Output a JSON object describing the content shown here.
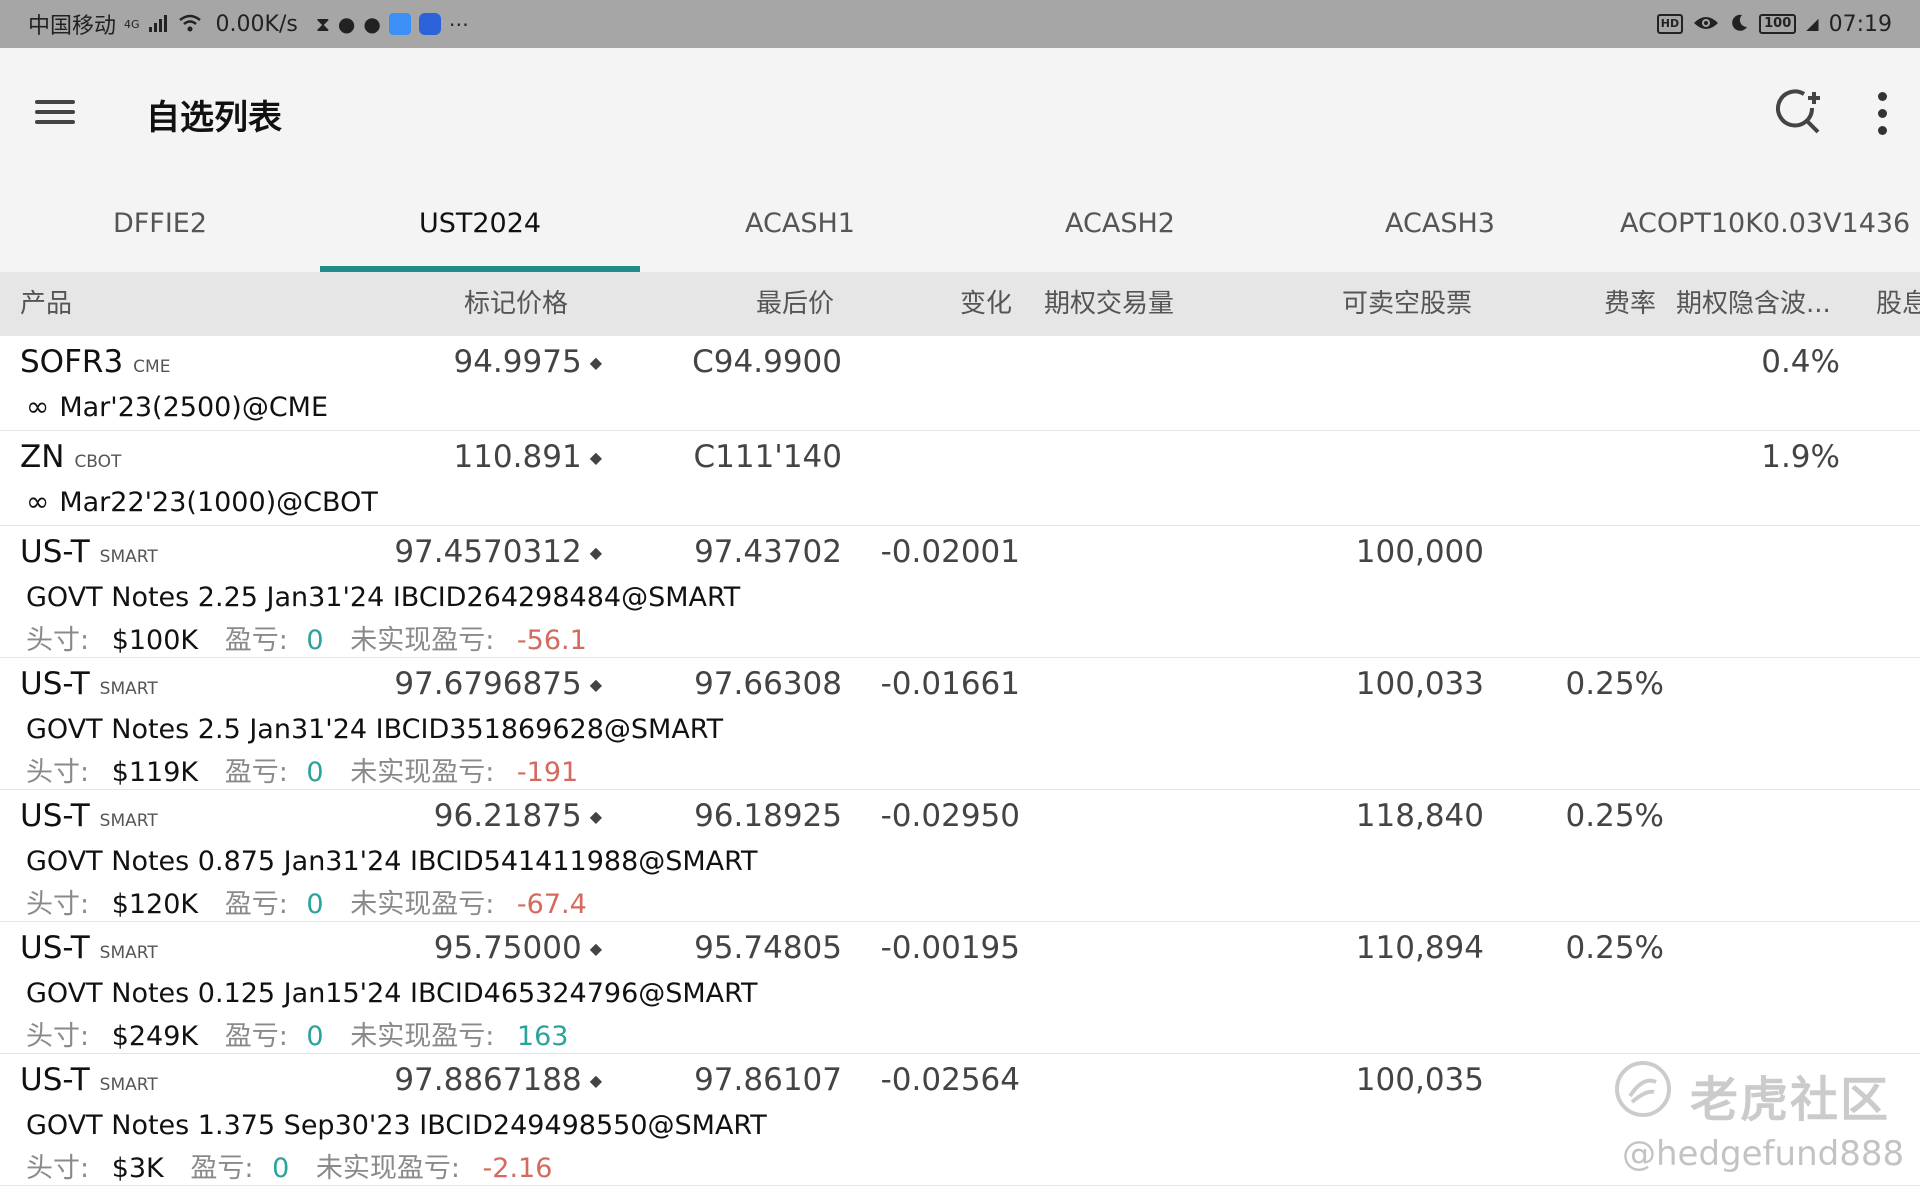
{
  "status_bar": {
    "carrier": "中国移动",
    "network": "4G",
    "speed": "0.00K/s",
    "hd": "HD",
    "battery": "100",
    "time": "07:19"
  },
  "appbar": {
    "title": "自选列表"
  },
  "tabs": [
    {
      "label": "DFFIE2",
      "active": false
    },
    {
      "label": "UST2024",
      "active": true
    },
    {
      "label": "ACASH1",
      "active": false
    },
    {
      "label": "ACASH2",
      "active": false
    },
    {
      "label": "ACASH3",
      "active": false
    },
    {
      "label": "ACOPT10K0.03V1436",
      "active": false
    }
  ],
  "columns": {
    "product": "产品",
    "mark_price": "标记价格",
    "last_price": "最后价",
    "change": "变化",
    "option_volume": "期权交易量",
    "shortable": "可卖空股票",
    "fee_rate": "费率",
    "implied_vol": "期权隐含波...",
    "dividend": "股息日"
  },
  "position_labels": {
    "position": "头寸:",
    "pnl": "盈亏:",
    "unrealized": "未实现盈亏:"
  },
  "rows": [
    {
      "symbol": "SOFR3",
      "exchange": "CME",
      "mark": "94.9975",
      "last": "C94.9900",
      "change": "",
      "shortable": "",
      "fee": "",
      "iv": "0.4%",
      "desc": "Mar'23(2500)@CME"
    },
    {
      "symbol": "ZN",
      "exchange": "CBOT",
      "mark": "110.891",
      "last": "C111'140",
      "change": "",
      "shortable": "",
      "fee": "",
      "iv": "1.9%",
      "desc": "Mar22'23(1000)@CBOT"
    },
    {
      "symbol": "US-T",
      "exchange": "SMART",
      "mark": "97.4570312",
      "last": "97.43702",
      "change": "-0.02001",
      "shortable": "100,000",
      "fee": "",
      "iv": "",
      "desc": "GOVT Notes 2.25 Jan31'24 IBCID264298484@SMART",
      "position": "$100K",
      "pnl": "0",
      "unrealized": "-56.1",
      "unrealized_color": "red"
    },
    {
      "symbol": "US-T",
      "exchange": "SMART",
      "mark": "97.6796875",
      "last": "97.66308",
      "change": "-0.01661",
      "shortable": "100,033",
      "fee": "0.25%",
      "iv": "",
      "desc": "GOVT Notes 2.5 Jan31'24 IBCID351869628@SMART",
      "position": "$119K",
      "pnl": "0",
      "unrealized": "-191",
      "unrealized_color": "red"
    },
    {
      "symbol": "US-T",
      "exchange": "SMART",
      "mark": "96.21875",
      "last": "96.18925",
      "change": "-0.02950",
      "shortable": "118,840",
      "fee": "0.25%",
      "iv": "",
      "desc": "GOVT Notes 0.875 Jan31'24 IBCID541411988@SMART",
      "position": "$120K",
      "pnl": "0",
      "unrealized": "-67.4",
      "unrealized_color": "red"
    },
    {
      "symbol": "US-T",
      "exchange": "SMART",
      "mark": "95.75000",
      "last": "95.74805",
      "change": "-0.00195",
      "shortable": "110,894",
      "fee": "0.25%",
      "iv": "",
      "desc": "GOVT Notes 0.125 Jan15'24 IBCID465324796@SMART",
      "position": "$249K",
      "pnl": "0",
      "unrealized": "163",
      "unrealized_color": "teal"
    },
    {
      "symbol": "US-T",
      "exchange": "SMART",
      "mark": "97.8867188",
      "last": "97.86107",
      "change": "-0.02564",
      "shortable": "100,035",
      "fee": "",
      "iv": "",
      "desc": "GOVT Notes 1.375 Sep30'23 IBCID249498550@SMART",
      "position": "$3K",
      "pnl": "0",
      "unrealized": "-2.16",
      "unrealized_color": "red"
    }
  ],
  "watermark": {
    "brand": "老虎社区",
    "handle": "@hedgefund888"
  }
}
